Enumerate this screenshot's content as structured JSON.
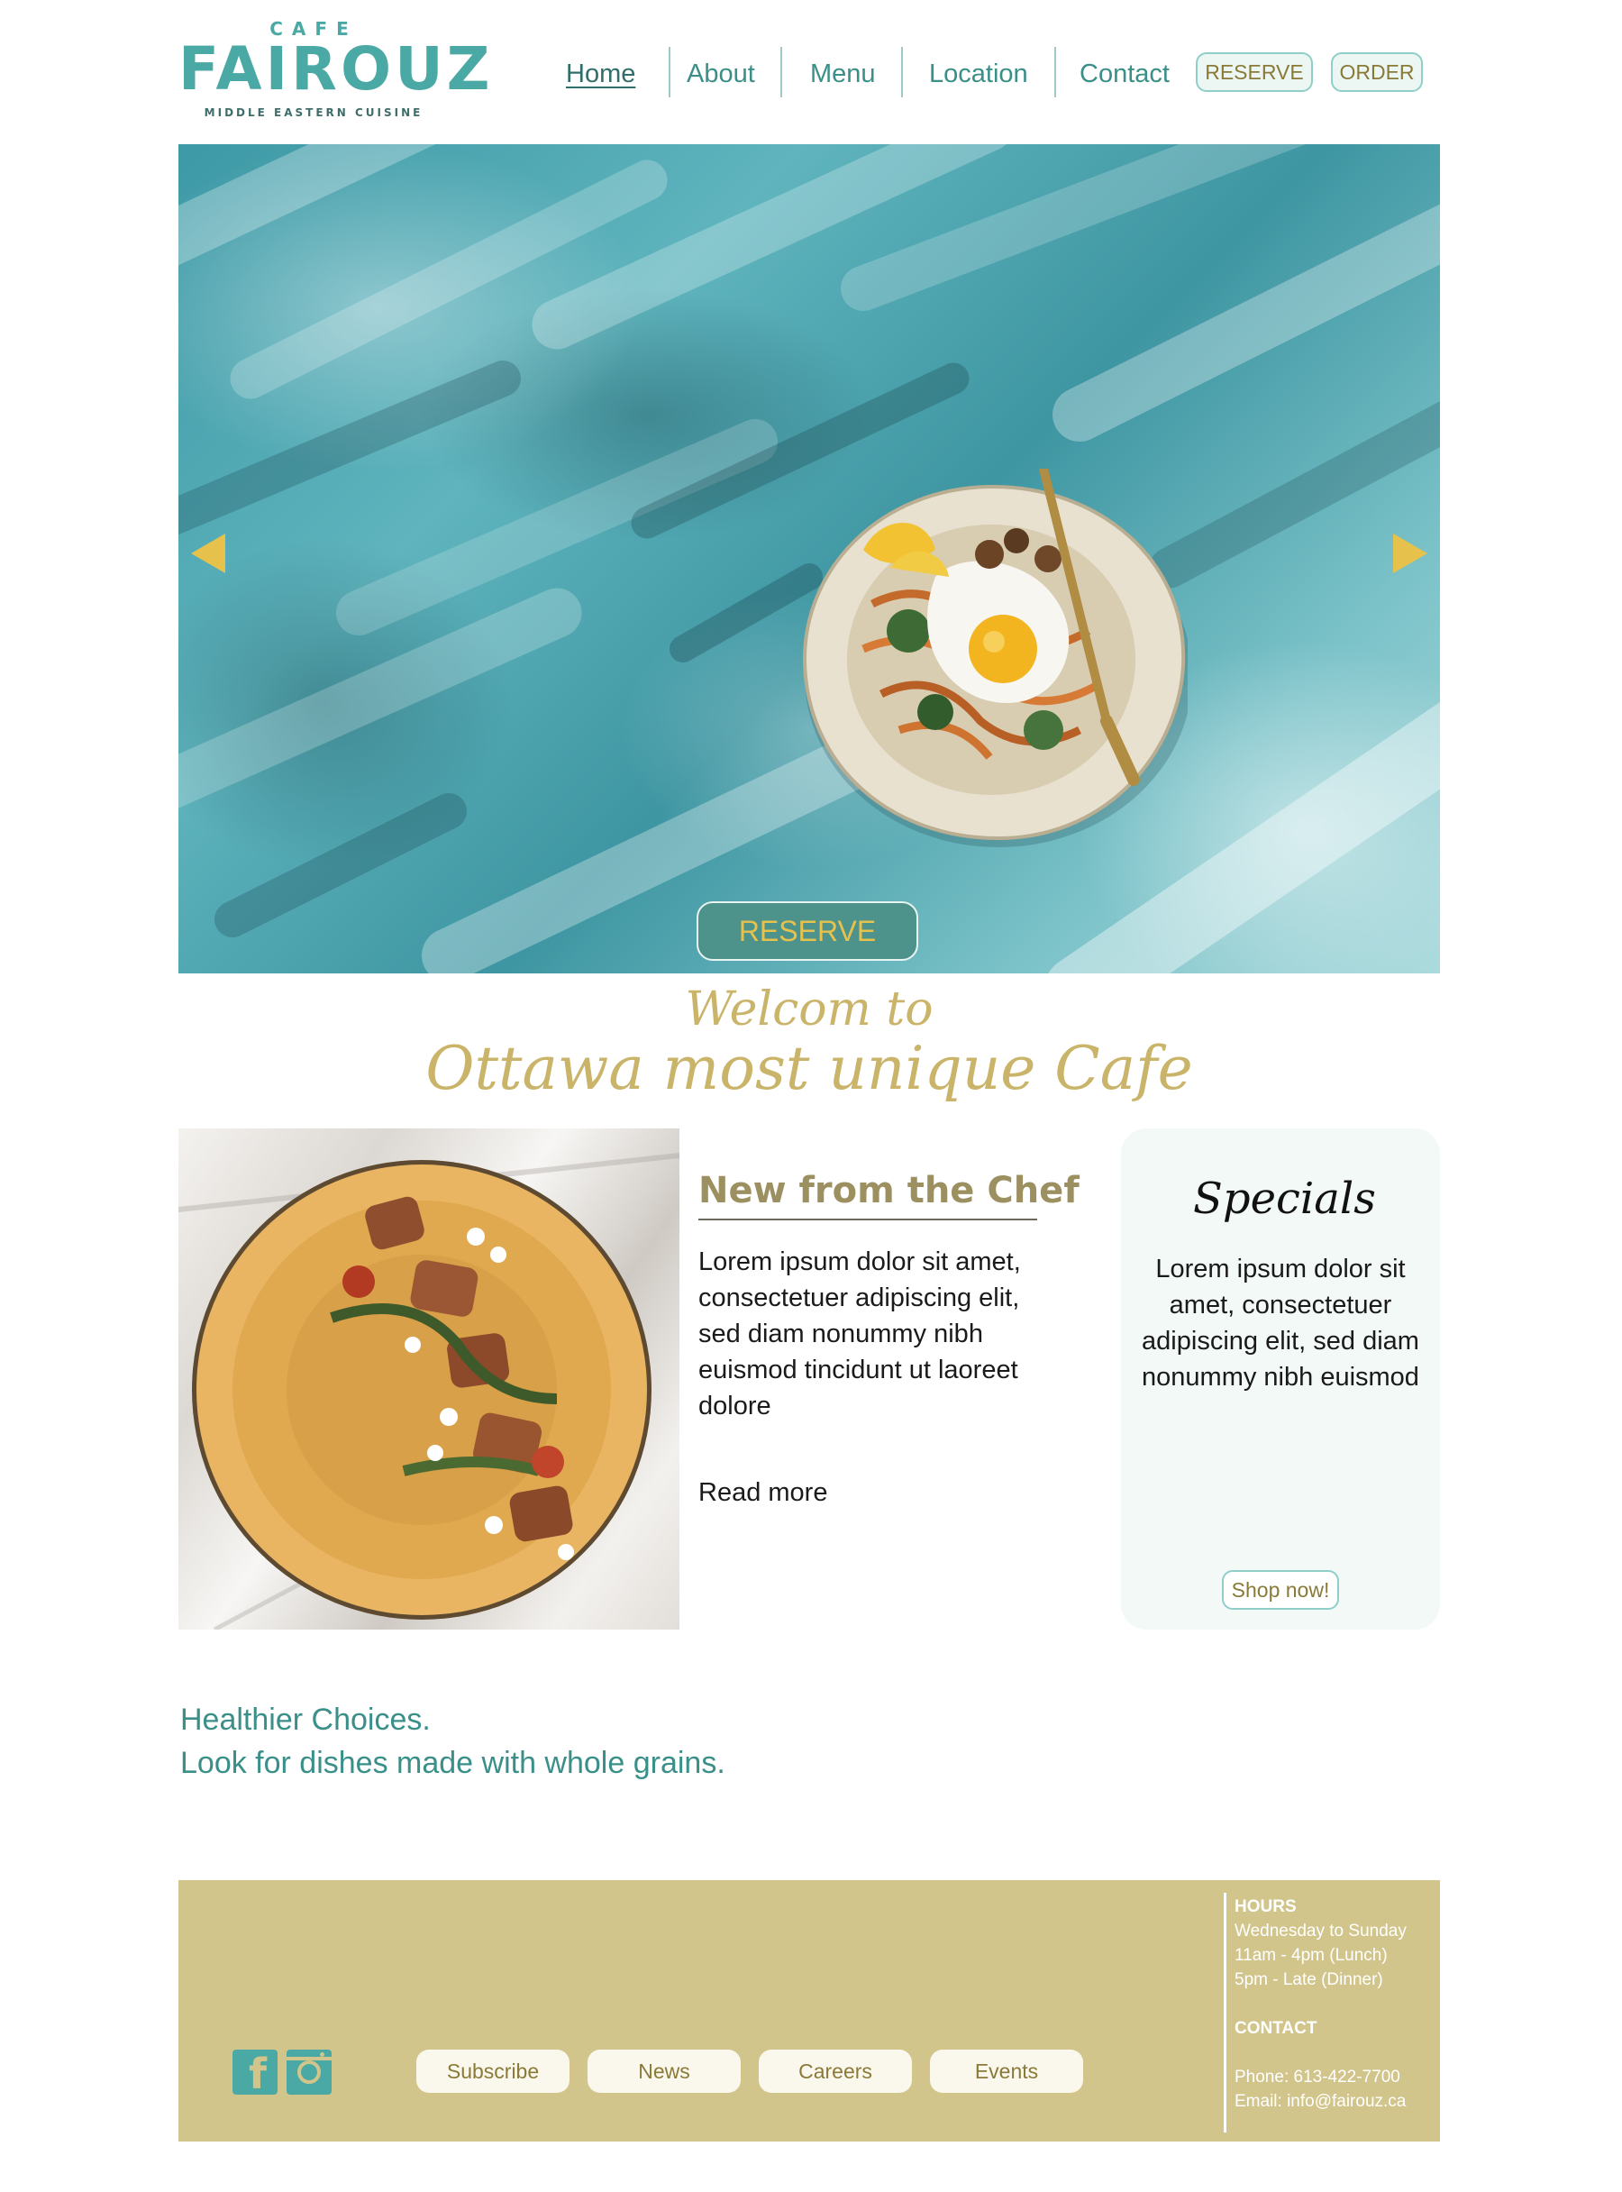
{
  "brand": {
    "cafe": "CAFE",
    "name": "FAIROUZ",
    "tagline": "MIDDLE EASTERN CUISINE"
  },
  "nav": {
    "items": [
      {
        "label": "Home",
        "active": true
      },
      {
        "label": "About"
      },
      {
        "label": "Menu"
      },
      {
        "label": "Location"
      },
      {
        "label": "Contact"
      }
    ],
    "reserve_label": "RESERVE",
    "order_label": "ORDER"
  },
  "hero": {
    "reserve_label": "RESERVE",
    "prev_icon": "arrow-left-icon",
    "next_icon": "arrow-right-icon"
  },
  "welcome": {
    "line1": "Welcom to",
    "line2": "Ottawa most unique Cafe"
  },
  "chef": {
    "title": "New from the Chef",
    "body": "Lorem ipsum dolor sit amet, consectetuer adipiscing elit, sed diam nonummy nibh euismod tincidunt ut laoreet dolore",
    "read_more": "Read more"
  },
  "specials": {
    "title": "Specials",
    "body": "Lorem ipsum dolor sit amet, consectetuer adipiscing elit, sed diam nonummy nibh euismod",
    "button": "Shop now!"
  },
  "healthy": {
    "line1": "Healthier Choices.",
    "line2": "Look for dishes made with whole grains."
  },
  "footer": {
    "social": [
      "facebook-icon",
      "instagram-icon"
    ],
    "links": [
      "Subscribe",
      "News",
      "Careers",
      "Events"
    ],
    "hours_title": "HOURS",
    "hours": [
      "Wednesday to Sunday",
      "11am - 4pm (Lunch)",
      "5pm - Late (Dinner)"
    ],
    "contact_title": "CONTACT",
    "phone": "Phone: 613-422-7700",
    "email": "Email: info@fairouz.ca"
  },
  "colors": {
    "teal": "#4aa9a4",
    "nav_text": "#3a8f89",
    "gold": "#c9b46a",
    "accent_yellow": "#e6c24c",
    "footer_bg": "#d2c58b",
    "hero_button_bg": "#4d938c"
  }
}
